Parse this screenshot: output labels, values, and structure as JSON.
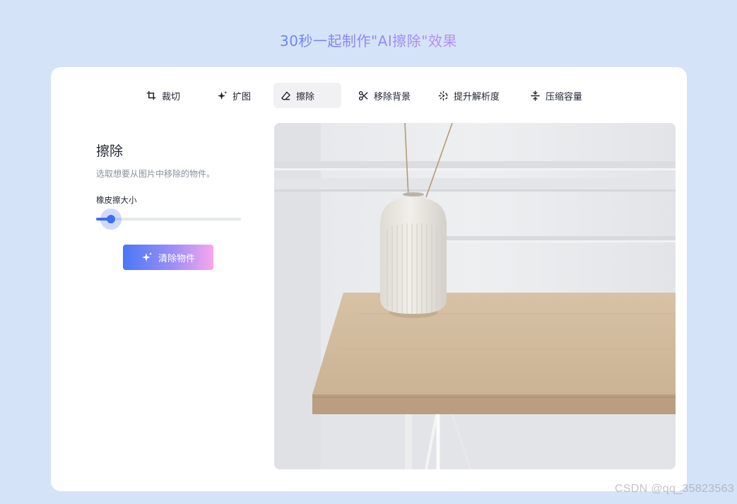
{
  "title": "30秒一起制作\"AI擦除\"效果",
  "tabs": [
    {
      "label": "裁切",
      "icon": "crop-icon"
    },
    {
      "label": "扩图",
      "icon": "sparkle-icon"
    },
    {
      "label": "擦除",
      "icon": "eraser-icon",
      "active": true
    },
    {
      "label": "移除背景",
      "icon": "scissors-icon"
    },
    {
      "label": "提升解析度",
      "icon": "enhance-icon"
    },
    {
      "label": "压缩容量",
      "icon": "compress-icon"
    }
  ],
  "panel": {
    "title": "擦除",
    "description": "选取想要从图片中移除的物件。",
    "slider_label": "橡皮擦大小",
    "slider_value": 0.1,
    "action_label": "清除物件"
  },
  "colors": {
    "background": "#d5e3f8",
    "accent": "#3f6df0",
    "gradient_start": "#4a78f5",
    "gradient_end": "#f8a6ec"
  },
  "watermark": "CSDN @qq_35823563"
}
